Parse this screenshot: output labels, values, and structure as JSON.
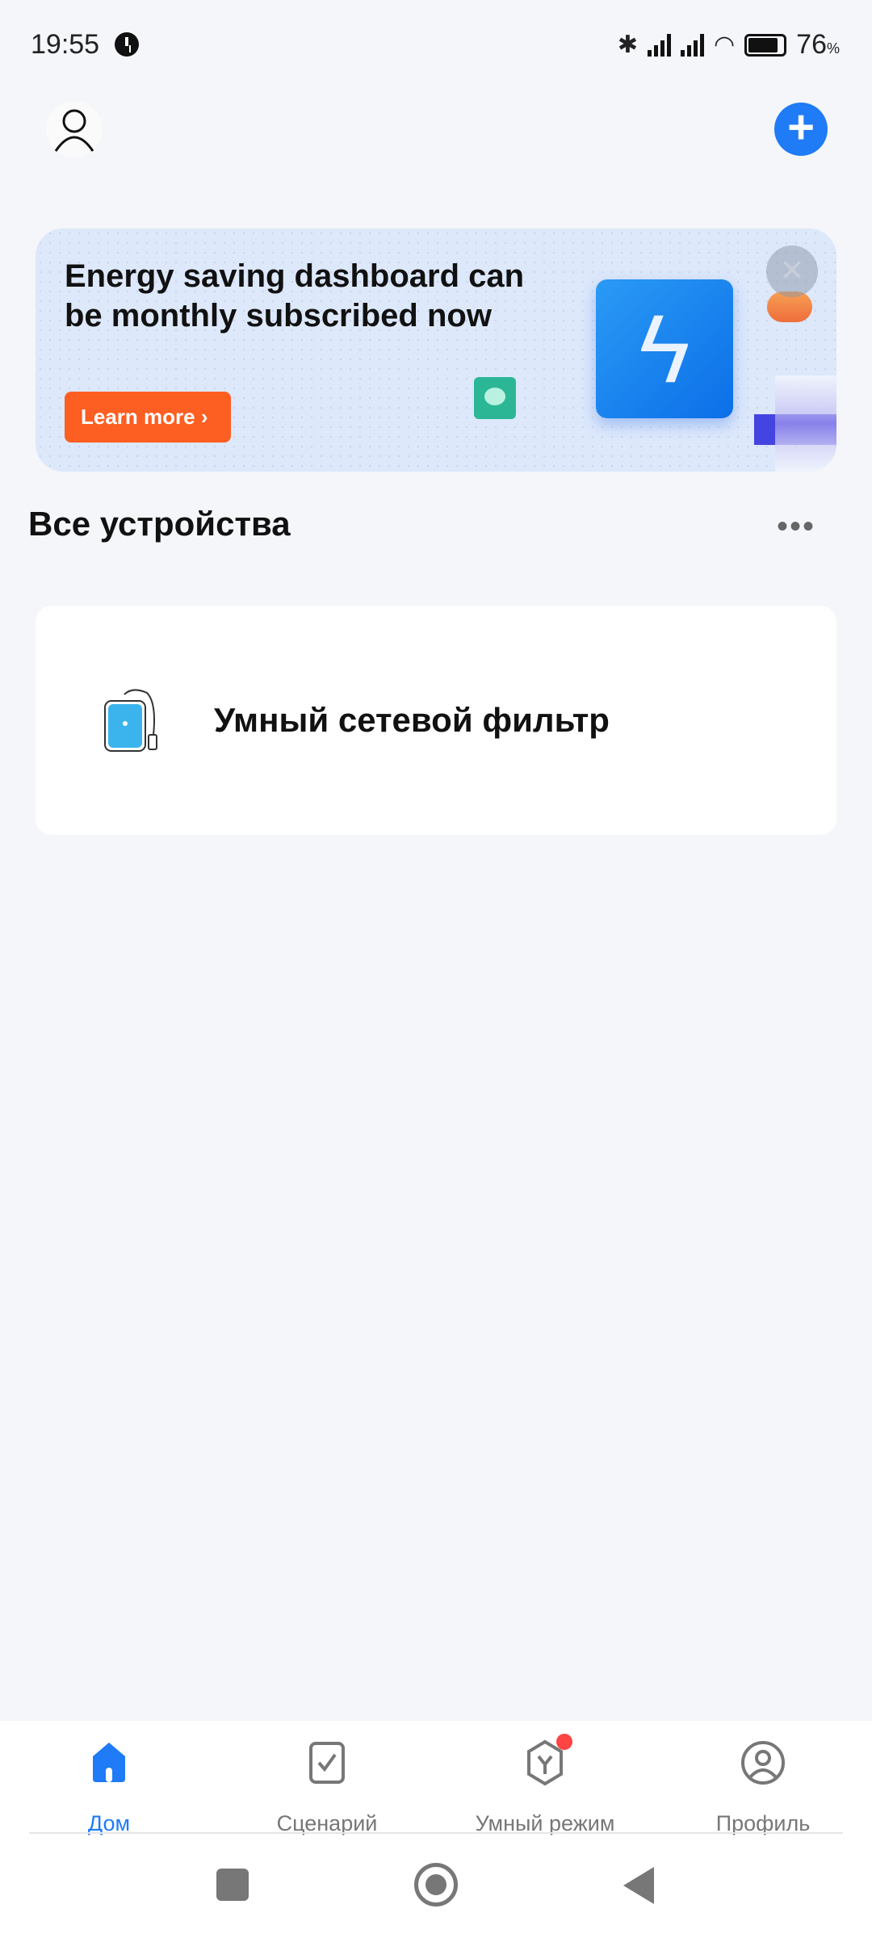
{
  "status_bar": {
    "time": "19:55",
    "battery": "76",
    "battery_unit": "%",
    "battery_level": 76
  },
  "header": {
    "avatar_icon": "user-icon",
    "add_icon": "plus-icon",
    "add_label": "+"
  },
  "banner": {
    "title": "Energy saving dashboard can be monthly subscribed now",
    "button_label": "Learn more ›",
    "close_label": "×",
    "accent": "#fd5e22"
  },
  "section": {
    "title": "Все устройства",
    "more_label": "•••"
  },
  "devices": [
    {
      "name": "Умный сетевой фильтр",
      "icon": "power-strip-icon"
    }
  ],
  "bottom_nav": {
    "accent": "#1f7bf6",
    "items": [
      {
        "label": "Дом",
        "icon": "home-icon",
        "active": true
      },
      {
        "label": "Сценарий",
        "icon": "checkbox-icon"
      },
      {
        "label": "Умный режим",
        "icon": "cube-icon",
        "badge": true
      },
      {
        "label": "Профиль",
        "icon": "profile-icon"
      }
    ]
  }
}
